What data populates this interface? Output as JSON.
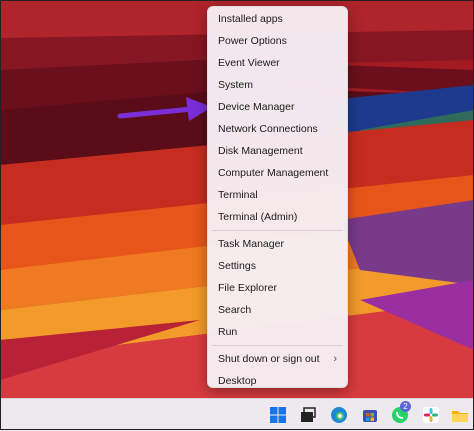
{
  "menu": {
    "items": [
      {
        "label": "Installed apps"
      },
      {
        "label": "Power Options"
      },
      {
        "label": "Event Viewer"
      },
      {
        "label": "System"
      },
      {
        "label": "Device Manager"
      },
      {
        "label": "Network Connections"
      },
      {
        "label": "Disk Management"
      },
      {
        "label": "Computer Management"
      },
      {
        "label": "Terminal"
      },
      {
        "label": "Terminal (Admin)"
      },
      {
        "label": "Task Manager"
      },
      {
        "label": "Settings"
      },
      {
        "label": "File Explorer"
      },
      {
        "label": "Search"
      },
      {
        "label": "Run"
      },
      {
        "label": "Shut down or sign out",
        "submenu": true
      },
      {
        "label": "Desktop"
      }
    ],
    "submenu_glyph": "›"
  },
  "annotation": {
    "arrow_color": "#7a2ed8",
    "points_to": "Device Manager"
  },
  "taskbar": {
    "icons": [
      "start-icon",
      "task-view-icon",
      "edge-icon",
      "store-icon",
      "whatsapp-icon",
      "slack-icon",
      "file-explorer-icon"
    ],
    "whatsapp_badge": "2"
  },
  "colors": {
    "menu_bg": "#f6eef4",
    "taskbar_bg": "#eee8ef",
    "wallpaper_red": "#a81c22"
  }
}
